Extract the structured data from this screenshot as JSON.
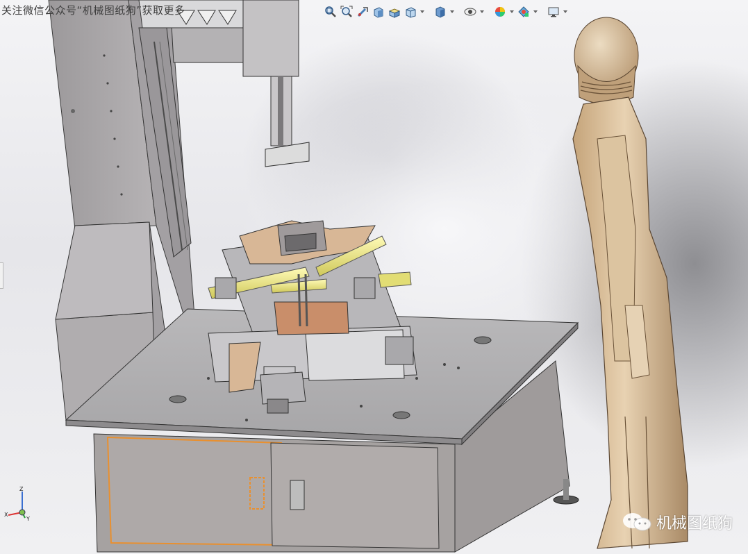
{
  "watermark": {
    "top_text": "关注微信公众号“机械图纸狗”获取更多",
    "bottom_text": "机械图纸狗"
  },
  "icons": {
    "toolbar": [
      "zoom-to-fit-icon",
      "zoom-to-area-icon",
      "previous-view-icon",
      "section-view-icon",
      "dynamic-annotation-view-icon",
      "view-orientation-icon",
      "display-style-icon",
      "hide-show-items-icon",
      "edit-appearance-icon",
      "apply-scene-icon",
      "view-settings-icon"
    ],
    "watermark": "wechat-icon",
    "triad": "coordinate-triad-icon"
  },
  "colors": {
    "frame_gray": "#a9a6a8",
    "table_top": "#b7b6b8",
    "cabinet_door": "#aea9a8",
    "door_highlight": "#e9902f",
    "mannequin": "#d2b791",
    "cylinder_yellow": "#f2ee8c",
    "cardboard": "#d8b796"
  }
}
